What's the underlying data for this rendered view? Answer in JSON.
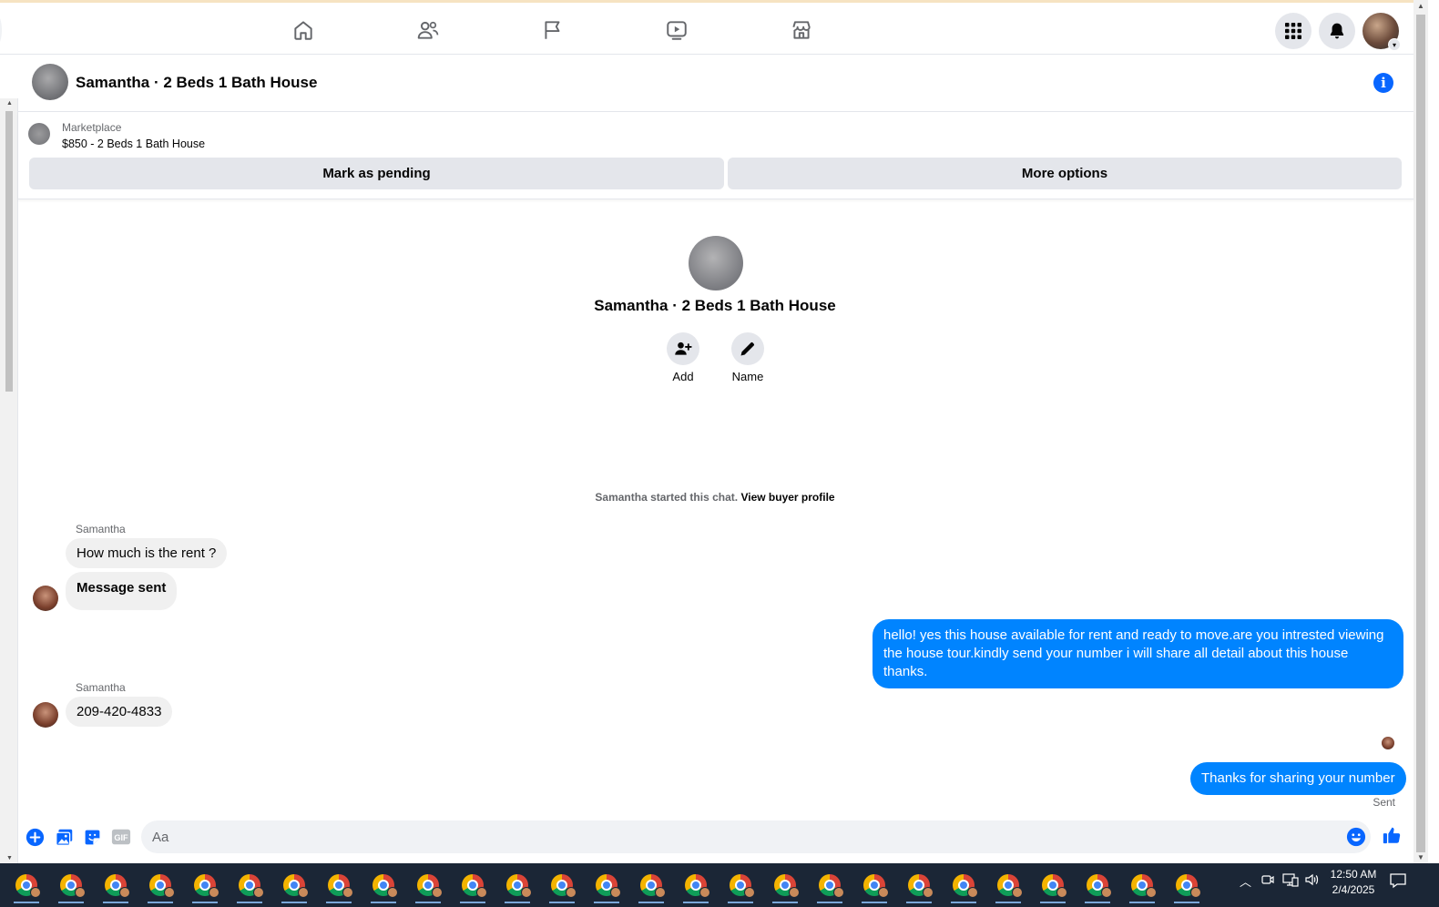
{
  "nav": {
    "tabs": [
      "home-icon",
      "friends-icon",
      "pages-flag-icon",
      "watch-video-icon",
      "marketplace-store-icon"
    ],
    "right_buttons": [
      "menu-grid-icon",
      "notifications-bell-icon",
      "account-avatar"
    ]
  },
  "chat": {
    "title": "Samantha · 2 Beds 1 Bath House"
  },
  "marketplace": {
    "label": "Marketplace",
    "listing": "$850 - 2 Beds 1 Bath House",
    "mark_pending": "Mark as pending",
    "more_options": "More options"
  },
  "profile": {
    "name": "Samantha · 2 Beds 1 Bath House",
    "actions": [
      {
        "label": "Add",
        "icon": "add-person-icon"
      },
      {
        "label": "Name",
        "icon": "pencil-icon"
      }
    ]
  },
  "started": {
    "text": "Samantha started this chat.",
    "link": "View buyer profile"
  },
  "messages": {
    "sender": "Samantha",
    "m1": "How much is the rent ?",
    "m2": "Message sent",
    "out1_line1": "hello! yes this house available for rent and ready to move.are you intrested viewing",
    "out1_line2": "the house tour.kindly send your number i will share all detail about this house thanks.",
    "m3": "209-420-4833",
    "out2": "Thanks for sharing your number",
    "status": "Sent"
  },
  "composer": {
    "placeholder": "Aa",
    "icons": [
      "plus-circle-icon",
      "photo-icon",
      "sticker-icon",
      "gif-icon",
      "emoji-icon",
      "like-thumb-icon"
    ]
  },
  "taskbar": {
    "time": "12:50 AM",
    "date": "2/4/2025",
    "app_count": 27
  },
  "colors": {
    "accent": "#0866ff",
    "outgoing_bubble": "#0084ff",
    "incoming_bubble": "#f0f0f0",
    "button_gray": "#e4e6eb",
    "taskbar": "#1b2636"
  }
}
